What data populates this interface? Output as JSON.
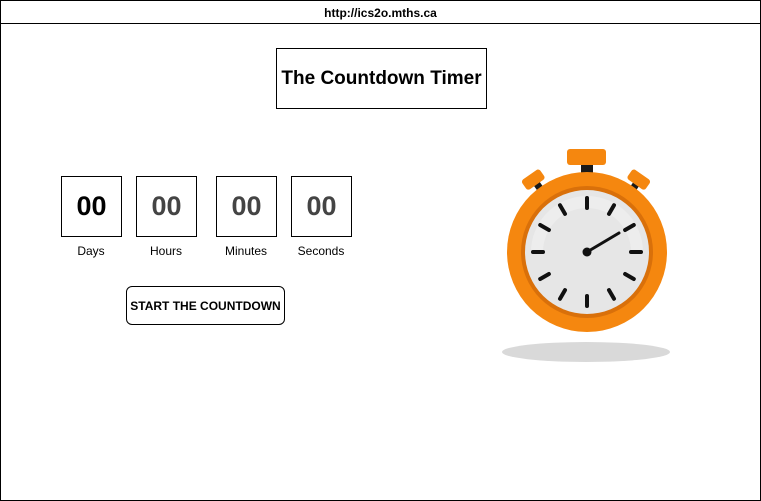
{
  "browser": {
    "url": "http://ics2o.mths.ca"
  },
  "page": {
    "title": "The Countdown Timer"
  },
  "countdown": {
    "units": [
      {
        "value": "00",
        "label": "Days"
      },
      {
        "value": "00",
        "label": "Hours"
      },
      {
        "value": "00",
        "label": "Minutes"
      },
      {
        "value": "00",
        "label": "Seconds"
      }
    ],
    "start_label": "START THE COUNTDOWN"
  },
  "colors": {
    "stopwatch_body": "#f5870f",
    "stopwatch_face": "#e6e6e6",
    "shadow": "#d9d9d9"
  }
}
